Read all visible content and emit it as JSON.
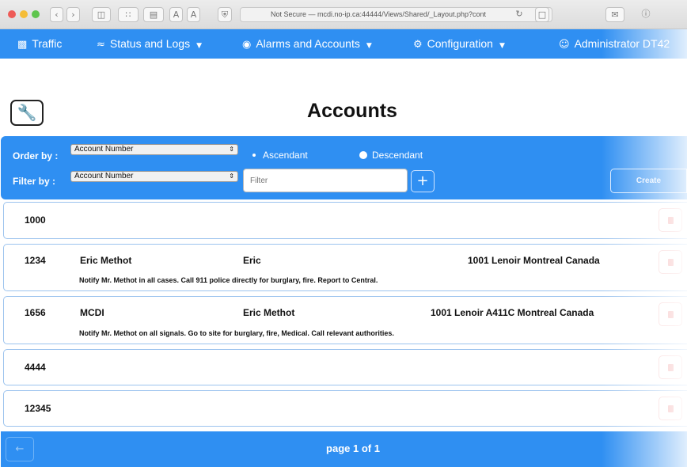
{
  "browser": {
    "url": "Not Secure — mcdi.no-ip.ca:44444/Views/Shared/_Layout.php?cont",
    "icons": [
      "back-icon",
      "forward-icon",
      "sidebar-icon",
      "grid-icon",
      "reader-icon",
      "shield-icon",
      "reload-icon",
      "tab-icon",
      "mail-icon",
      "info-icon"
    ],
    "text_small": "A",
    "text_large": "A"
  },
  "nav": {
    "traffic": "Traffic",
    "status_logs": "Status and Logs",
    "alarms_accounts": "Alarms and Accounts",
    "configuration": "Configuration",
    "user": "Administrator DT42"
  },
  "page": {
    "title": "Accounts"
  },
  "filters": {
    "order_label": "Order by :",
    "order_value": "Account Number",
    "filter_label": "Filter by :",
    "filter_value": "Account Number",
    "ascendant": "Ascendant",
    "descendant": "Descendant",
    "selected_order": "Descendant",
    "filter_placeholder": "Filter",
    "add_label": "+",
    "create_label": "Create"
  },
  "accounts": [
    {
      "number": "1000",
      "name": "",
      "contact": "",
      "address": "",
      "note": ""
    },
    {
      "number": "1234",
      "name": "Eric Methot",
      "contact": "Eric",
      "address": "1001 Lenoir Montreal Canada",
      "note": "Notify Mr. Methot in all cases. Call 911 police directly for burglary, fire. Report to Central."
    },
    {
      "number": "1656",
      "name": "MCDI",
      "contact": "Eric Methot",
      "address": "1001 Lenoir A411C Montreal Canada",
      "note": "Notify Mr. Methot on all signals. Go to site for burglary, fire, Medical. Call relevant authorities."
    },
    {
      "number": "4444",
      "name": "",
      "contact": "",
      "address": "",
      "note": ""
    },
    {
      "number": "12345",
      "name": "",
      "contact": "",
      "address": "",
      "note": ""
    }
  ],
  "pagination": {
    "label": "page 1 of 1",
    "prev": "←"
  },
  "colors": {
    "accent": "#2f8ff2",
    "delete": "#f2a3a3"
  }
}
